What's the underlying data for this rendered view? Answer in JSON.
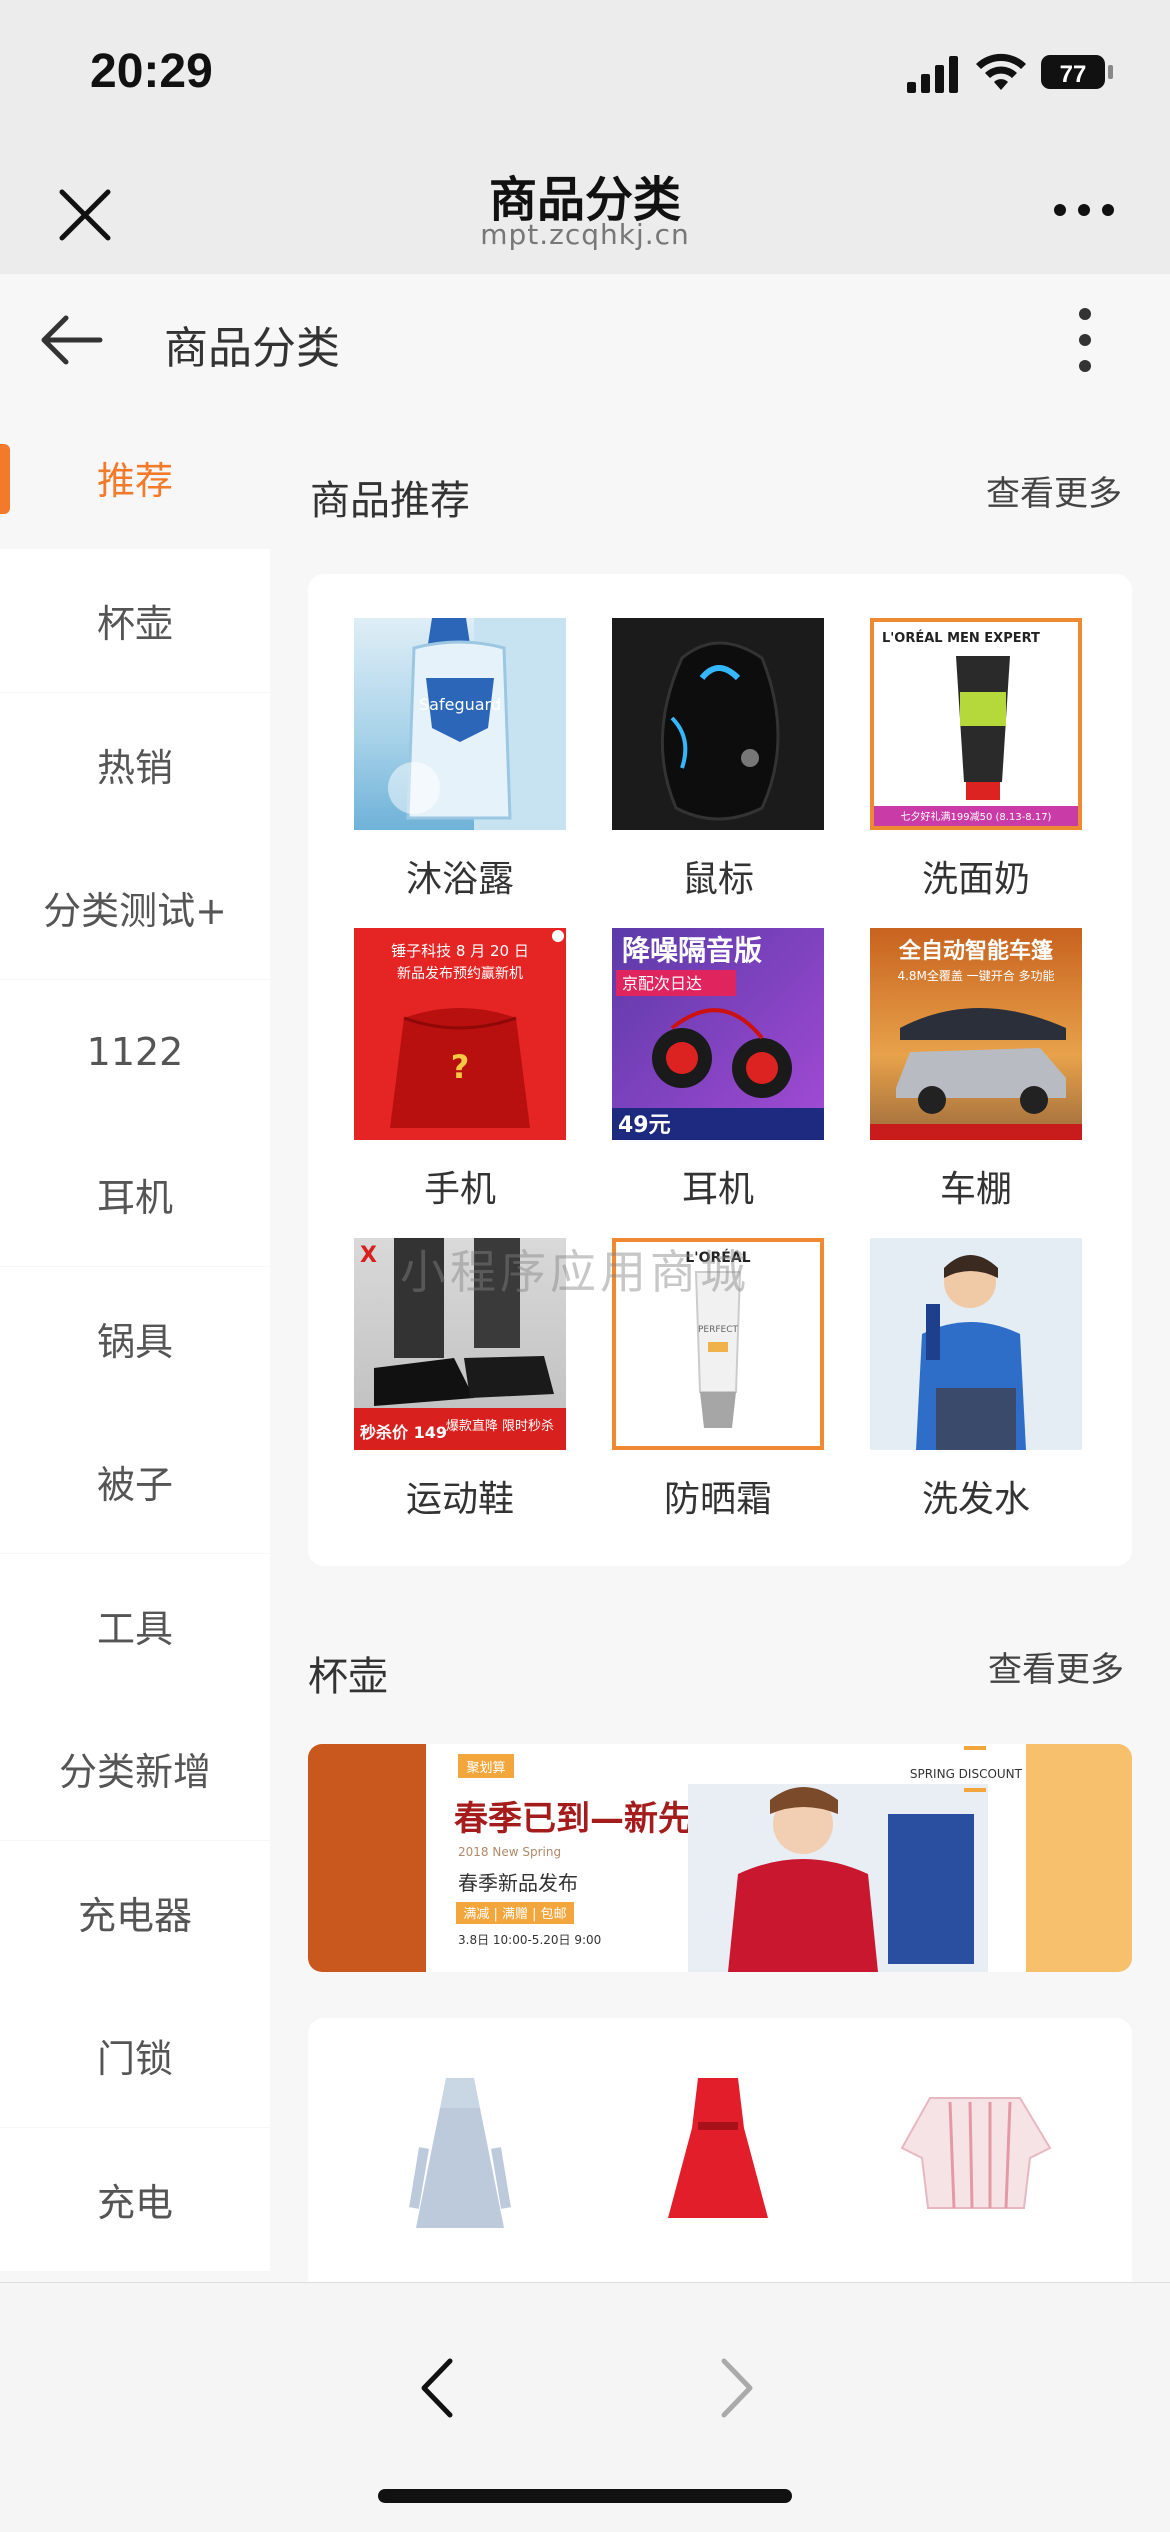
{
  "status_bar": {
    "time": "20:29",
    "battery": "77"
  },
  "nav": {
    "title": "商品分类",
    "domain": "mpt.zcqhkj.cn"
  },
  "page": {
    "title": "商品分类"
  },
  "sidebar": {
    "items": [
      {
        "label": "推荐",
        "active": true
      },
      {
        "label": "杯壶"
      },
      {
        "label": "热销"
      },
      {
        "label": "分类测试+"
      },
      {
        "label": "1122"
      },
      {
        "label": "耳机"
      },
      {
        "label": "锅具"
      },
      {
        "label": "被子"
      },
      {
        "label": "工具"
      },
      {
        "label": "分类新增"
      },
      {
        "label": "充电器"
      },
      {
        "label": "门锁"
      },
      {
        "label": "充电"
      }
    ]
  },
  "recommend": {
    "title": "商品推荐",
    "more": "查看更多",
    "products": [
      {
        "label": "沐浴露",
        "image_text": "Safeguard"
      },
      {
        "label": "鼠标"
      },
      {
        "label": "洗面奶",
        "image_text": "L'ORÉAL MEN EXPERT",
        "image_caption": "七夕好礼满199减50 (8.13-8.17)"
      },
      {
        "label": "手机",
        "image_text": "锤子科技 8 月 20 日",
        "image_caption": "新品发布预约赢新机"
      },
      {
        "label": "耳机",
        "image_text": "降噪隔音版",
        "image_caption": "京配次日达",
        "image_price": "49元"
      },
      {
        "label": "车棚",
        "image_text": "全自动智能车篷",
        "image_caption": "4.8M全覆盖 一键开合 多功能"
      },
      {
        "label": "运动鞋",
        "image_text": "秒杀价 149",
        "image_caption": "爆款直降 限时秒杀"
      },
      {
        "label": "防晒霜",
        "image_text": "L'ORÉAL",
        "image_caption": "PERFECT"
      },
      {
        "label": "洗发水"
      }
    ]
  },
  "watermark": "小程序应用商城",
  "cups": {
    "title": "杯壶",
    "more": "查看更多",
    "banner": {
      "badge": "聚划算",
      "headline": "春季已到—新先行",
      "sub_en": "2018 New Spring",
      "sub": "春季新品发布",
      "tags": "满减 | 满赠 | 包邮",
      "date": "3.8日 10:00-5.20日 9:00",
      "corner": "SPRING DISCOUNT"
    }
  },
  "colors": {
    "accent": "#f27a2a",
    "background": "#f7f7f7",
    "card": "#ffffff"
  }
}
